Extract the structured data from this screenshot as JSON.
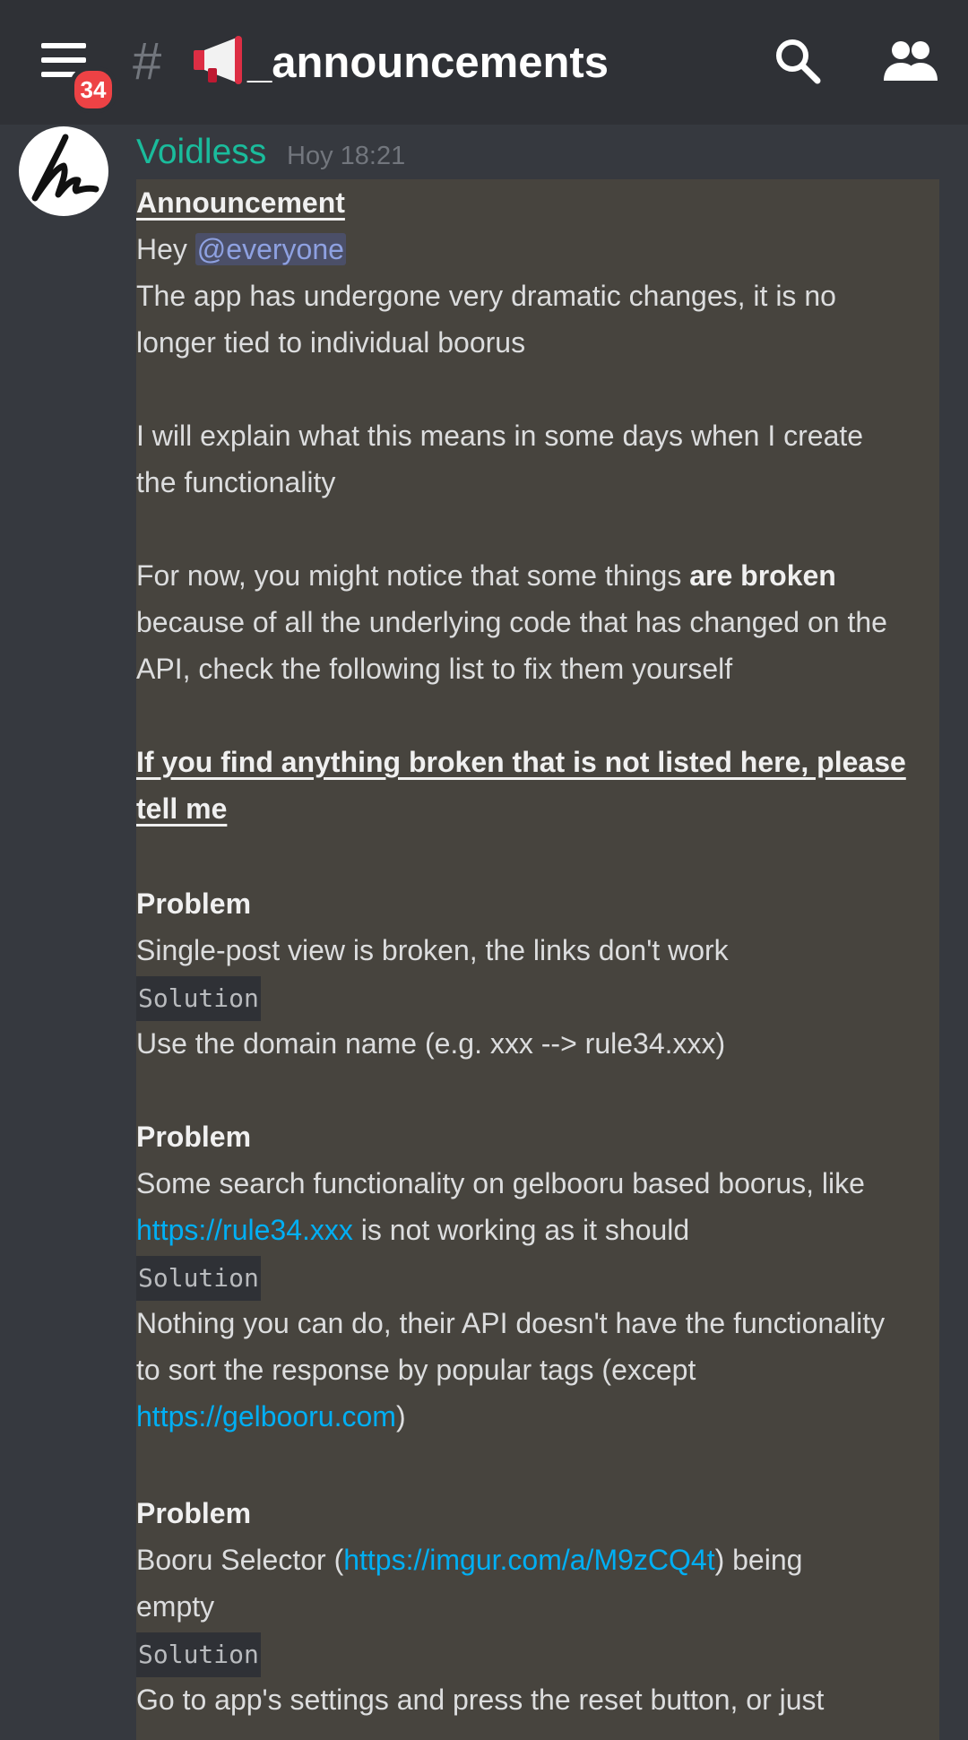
{
  "header": {
    "badge_count": "34",
    "channel_prefix": "#",
    "channel_name": "_announcements"
  },
  "message": {
    "author": "Voidless",
    "timestamp": "Hoy 18:21",
    "title": "Announcement",
    "greeting": "Hey ",
    "mention": "@everyone",
    "para1_line1": "The app has undergone very dramatic changes, it is no",
    "para1_line2": "longer tied to individual boorus",
    "para2_line1": "I will explain what this means in some days when I create",
    "para2_line2": "the functionality",
    "para3_line1_pre": "For now, you might notice that some things ",
    "para3_line1_bold": "are broken",
    "para3_line2": "because of all the underlying code that has changed on the",
    "para3_line3": "API, check the following list to fix them yourself",
    "notice_line1": "If you find anything broken that is not listed here, please",
    "notice_line2": "tell me",
    "problems": [
      {
        "problem_label": "Problem",
        "problem_line1": "Single-post view is broken, the links don't work",
        "solution_label": "Solution",
        "solution_line1": "Use the domain name (e.g. xxx --> rule34.xxx)"
      },
      {
        "problem_label": "Problem",
        "problem_line1": " Some search functionality on gelbooru based boorus, like",
        "problem_link": "https://rule34.xxx",
        "problem_line2_post": " is not working as it should",
        "solution_label": "Solution",
        "solution_line1": "Nothing you can do, their API doesn't have the functionality",
        "solution_line2": "to sort the response by popular tags (except",
        "solution_link": "https://gelbooru.com",
        "solution_line3_post": ")"
      },
      {
        "problem_label": "Problem",
        "problem_line1_pre": "Booru Selector (",
        "problem_link": "https://imgur.com/a/M9zCQ4t",
        "problem_line1_post": ") being",
        "problem_line2": "empty",
        "solution_label": "Solution",
        "solution_line1": "Go to app's settings and press the reset button, or just"
      }
    ]
  }
}
